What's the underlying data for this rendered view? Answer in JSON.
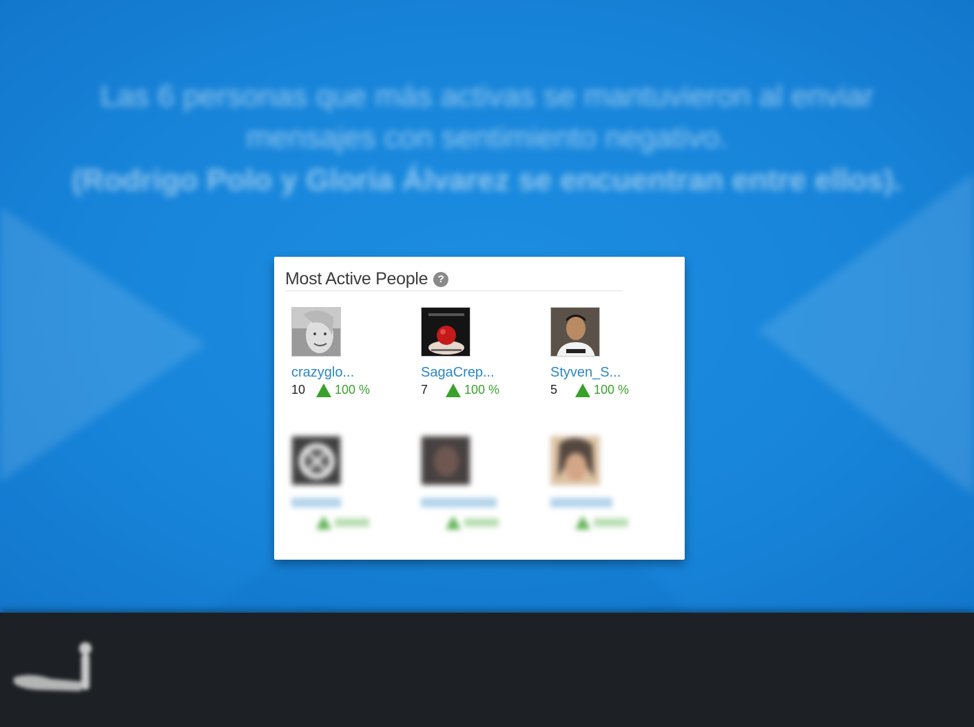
{
  "caption": {
    "line1": "Las 6 personas que más activas se mantuvieron al enviar",
    "line2": "mensajes con sentimiento negativo.",
    "line3": "(Rodrigo Polo y Gloria Álvarez se encuentran entre ellos)."
  },
  "widget": {
    "title": "Most Active People",
    "help_icon": "?",
    "people": [
      {
        "name": "crazyglo...",
        "count": "10",
        "percent": "100 %",
        "avatar": "woman-portrait-bw"
      },
      {
        "name": "SagaCrep...",
        "count": "7",
        "percent": "100 %",
        "avatar": "twilight-apple"
      },
      {
        "name": "Styven_S...",
        "count": "5",
        "percent": "100 %",
        "avatar": "young-man-portrait"
      },
      {
        "name": "",
        "count": "",
        "percent": "",
        "avatar": "dark-emblem"
      },
      {
        "name": "",
        "count": "",
        "percent": "",
        "avatar": "dark-portrait"
      },
      {
        "name": "",
        "count": "",
        "percent": "",
        "avatar": "woman-portrait-color"
      }
    ]
  },
  "colors": {
    "background": "#1a8be0",
    "link": "#2a86c3",
    "positive": "#3aa02c",
    "footer": "#1d2024"
  }
}
